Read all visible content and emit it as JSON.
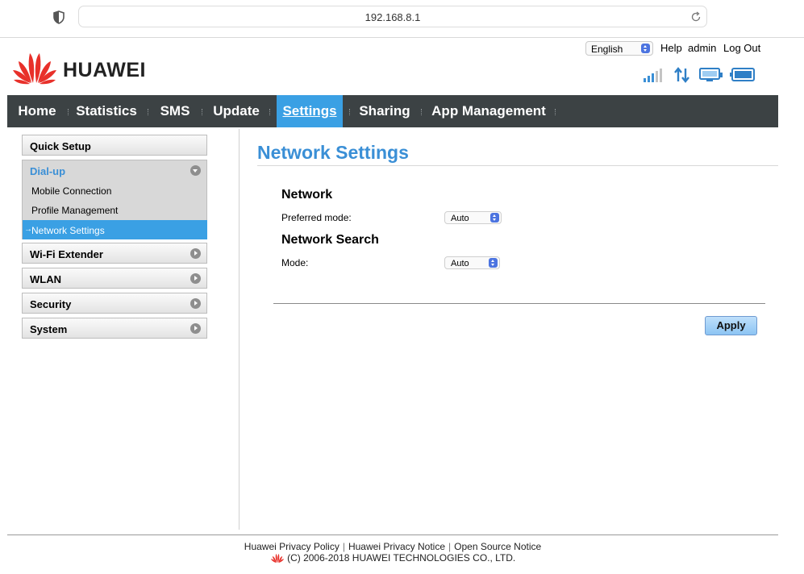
{
  "browser": {
    "url": "192.168.8.1"
  },
  "header": {
    "brand": "HUAWEI",
    "language": "English",
    "help": "Help",
    "user": "admin",
    "logout": "Log Out",
    "status_icons": [
      "signal-strength-icon",
      "data-transfer-icon",
      "connected-device-icon",
      "battery-icon"
    ]
  },
  "nav": {
    "items": [
      {
        "label": "Home"
      },
      {
        "label": "Statistics"
      },
      {
        "label": "SMS"
      },
      {
        "label": "Update"
      },
      {
        "label": "Settings",
        "active": true
      },
      {
        "label": "Sharing"
      },
      {
        "label": "App Management"
      }
    ]
  },
  "sidebar": {
    "sections": [
      {
        "label": "Quick Setup"
      },
      {
        "label": "Dial-up",
        "expanded": true,
        "items": [
          {
            "label": "Mobile Connection"
          },
          {
            "label": "Profile Management"
          },
          {
            "label": "Network Settings",
            "active": true
          }
        ]
      },
      {
        "label": "Wi-Fi Extender"
      },
      {
        "label": "WLAN"
      },
      {
        "label": "Security"
      },
      {
        "label": "System"
      }
    ]
  },
  "main": {
    "title": "Network Settings",
    "network": {
      "heading": "Network",
      "preferred_mode_label": "Preferred mode:",
      "preferred_mode_value": "Auto"
    },
    "search": {
      "heading": "Network Search",
      "mode_label": "Mode:",
      "mode_value": "Auto"
    },
    "apply": "Apply"
  },
  "footer": {
    "links": [
      "Huawei Privacy Policy",
      "Huawei Privacy Notice",
      "Open Source Notice"
    ],
    "copyright": "(C) 2006-2018 HUAWEI TECHNOLOGIES CO., LTD."
  },
  "colors": {
    "accent": "#3aa0e4",
    "nav_bg": "#3c4244",
    "title": "#3a8fd6",
    "brand_red": "#e8302a"
  }
}
